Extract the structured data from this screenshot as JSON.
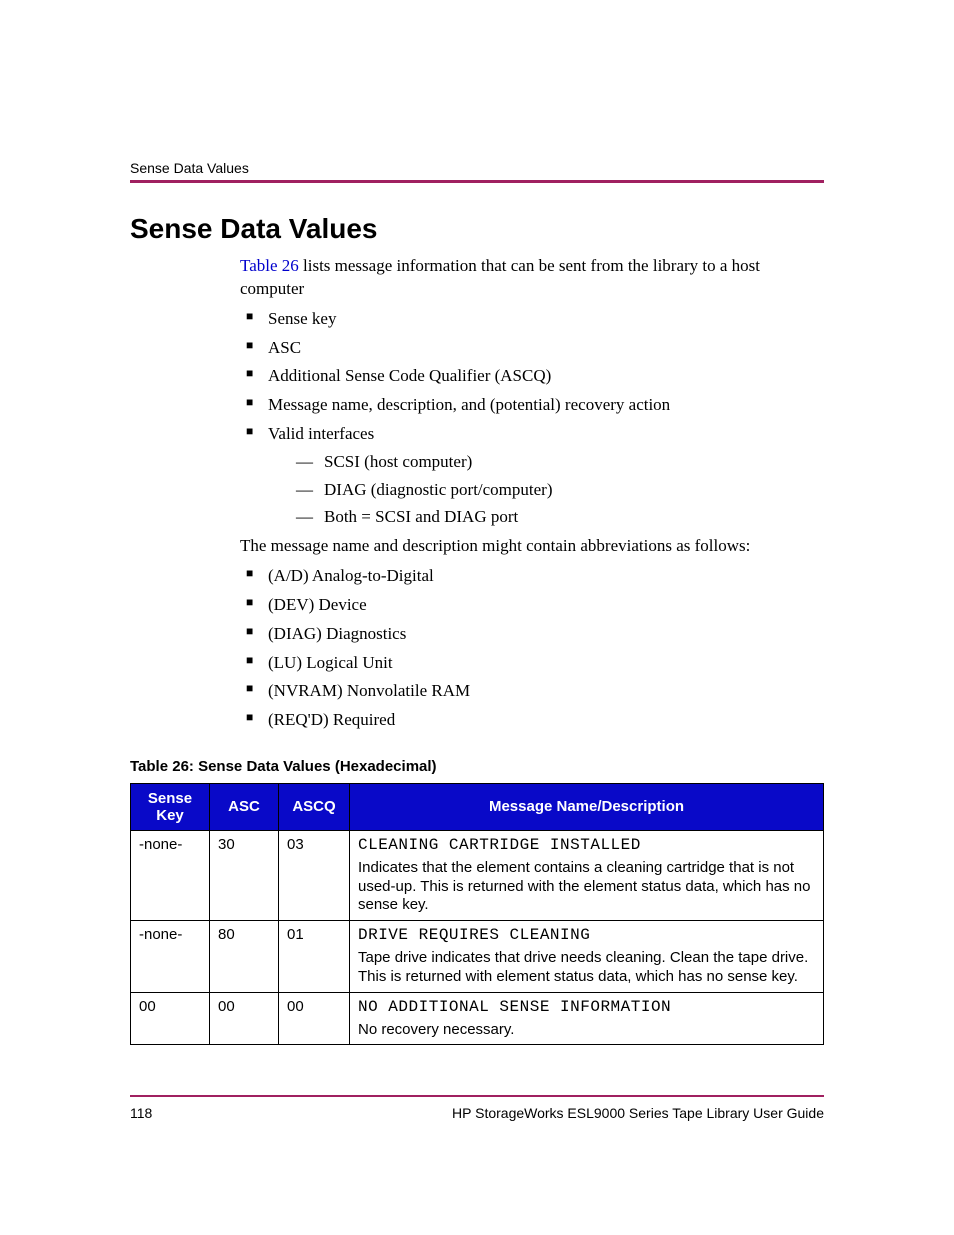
{
  "runningHead": "Sense Data Values",
  "sectionTitle": "Sense Data Values",
  "intro": {
    "refLabel": "Table 26",
    "afterRef": " lists message information that can be sent from the library to a host computer"
  },
  "list1": [
    "Sense key",
    "ASC",
    "Additional Sense Code Qualifier (ASCQ)",
    "Message name, description, and (potential) recovery action",
    "Valid interfaces"
  ],
  "sublist": [
    "SCSI (host computer)",
    "DIAG (diagnostic port/computer)",
    "Both = SCSI and DIAG port"
  ],
  "midPara": "The message name and description might contain abbreviations as follows:",
  "list2": [
    "(A/D) Analog-to-Digital",
    "(DEV) Device",
    "(DIAG) Diagnostics",
    "(LU) Logical Unit",
    "(NVRAM) Nonvolatile RAM",
    "(REQ'D) Required"
  ],
  "tableCaption": "Table 26:  Sense Data Values (Hexadecimal)",
  "tableHeaders": {
    "senseKey": "Sense Key",
    "asc": "ASC",
    "ascq": "ASCQ",
    "msg": "Message Name/Description"
  },
  "rows": [
    {
      "senseKey": "-none-",
      "asc": "30",
      "ascq": "03",
      "name": "CLEANING CARTRIDGE INSTALLED",
      "desc": "Indicates that the element contains a cleaning cartridge that is not used-up. This is returned with the element status data, which has no sense key."
    },
    {
      "senseKey": "-none-",
      "asc": "80",
      "ascq": "01",
      "name": "DRIVE REQUIRES CLEANING",
      "desc": "Tape drive indicates that drive needs cleaning. Clean the tape drive. This is returned with element status data, which has no sense key."
    },
    {
      "senseKey": "00",
      "asc": "00",
      "ascq": "00",
      "name": "NO ADDITIONAL SENSE INFORMATION",
      "desc": "No recovery necessary."
    }
  ],
  "footer": {
    "pageNum": "118",
    "docTitle": "HP StorageWorks ESL9000 Series Tape Library User Guide"
  }
}
